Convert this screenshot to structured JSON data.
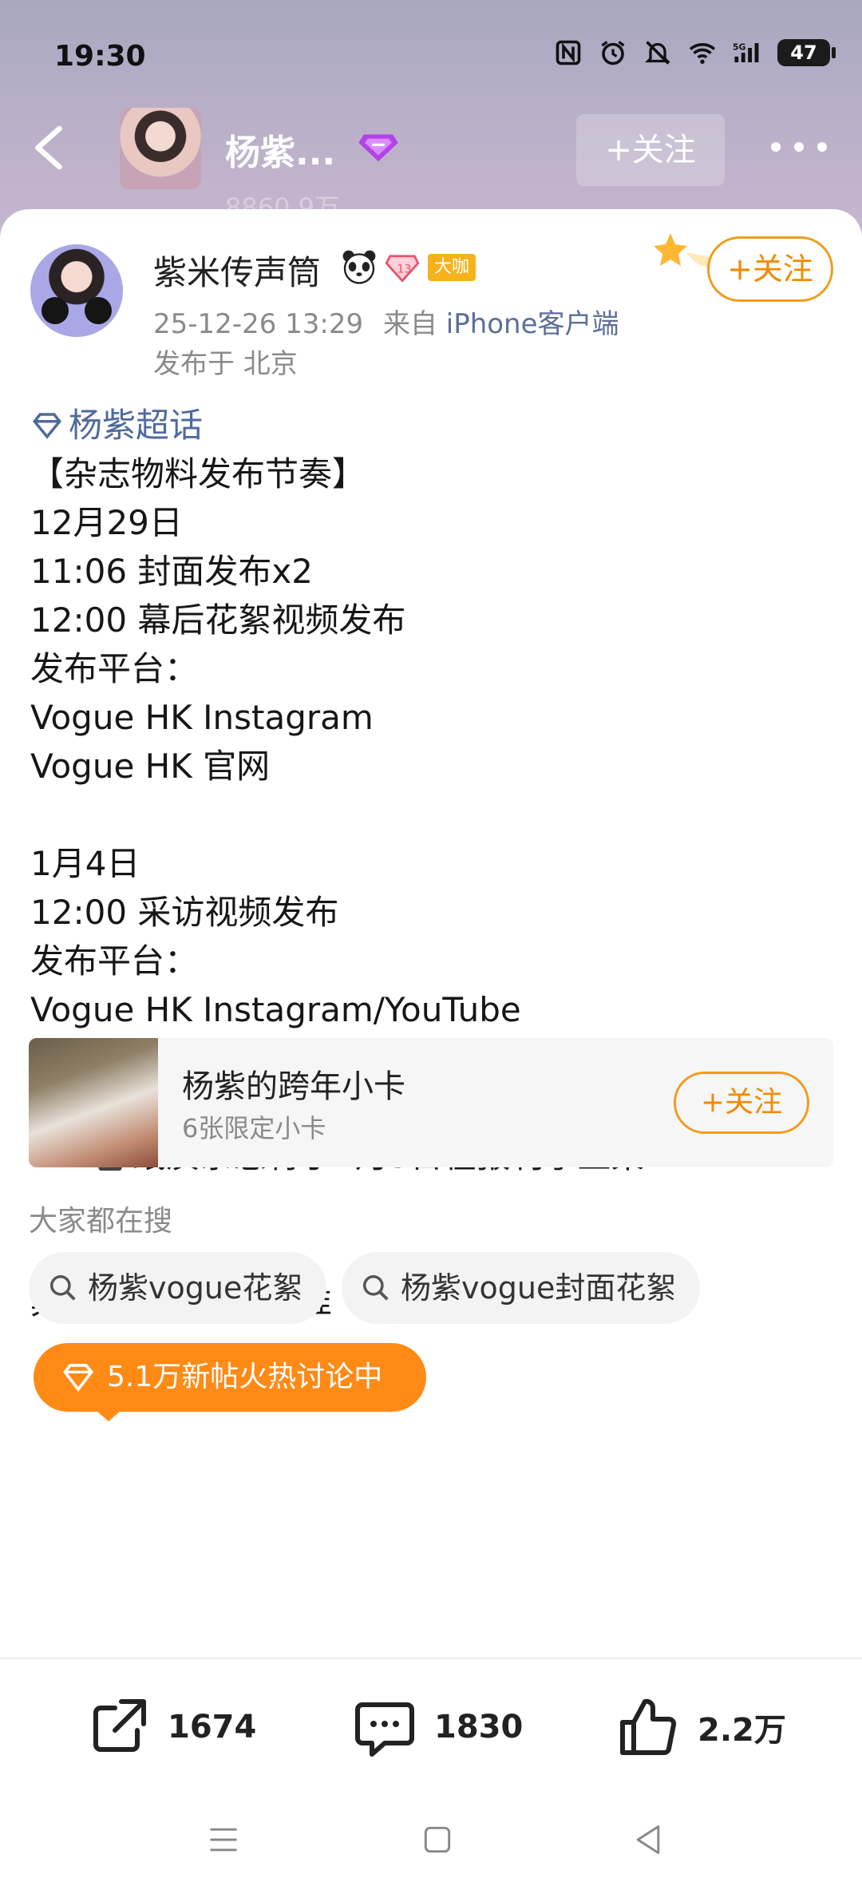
{
  "status_bar": {
    "time": "19:30",
    "battery": "47"
  },
  "header": {
    "name": "杨紫...",
    "follow_label": "+关注",
    "followers_ghost": "8860.9万",
    "icons": [
      "back-icon",
      "vip-gem-icon",
      "more-icon"
    ]
  },
  "post": {
    "author": "紫米传声筒",
    "badge": "大咖",
    "time": "25-12-26 13:29",
    "source_prefix": "来自",
    "source": "iPhone客户端",
    "location": "发布于 北京",
    "follow_label": "+关注",
    "topic": "杨紫超话",
    "lines": [
      "【杂志物料发布节奏】",
      "12月29日",
      "11:06 封面发布x2",
      "12:00 幕后花絮视频发布",
      "发布平台：",
      "Vogue HK Instagram",
      "Vogue HK 官网",
      "",
      "1月4日",
      "12:00 采访视频发布",
      "发布平台：",
      "Vogue HK Instagram/YouTube",
      ""
    ],
    "magazine_line": "纸质杂志将于1月5日在报刊亭上架",
    "blank": "",
    "closing_line": "具体以实际情况为准"
  },
  "promo": {
    "title": "杨紫的跨年小卡",
    "subtitle": "6张限定小卡",
    "follow_label": "+关注"
  },
  "search": {
    "title": "大家都在搜",
    "chips": [
      "杨紫vogue花絮",
      "杨紫vogue封面花絮"
    ]
  },
  "hot": {
    "label": "5.1万新帖火热讨论中"
  },
  "actions": {
    "share": "1674",
    "comment": "1830",
    "like": "2.2万"
  },
  "colors": {
    "accent": "#f08a00",
    "link": "#4f6a9c",
    "hot": "#ff8a16"
  }
}
